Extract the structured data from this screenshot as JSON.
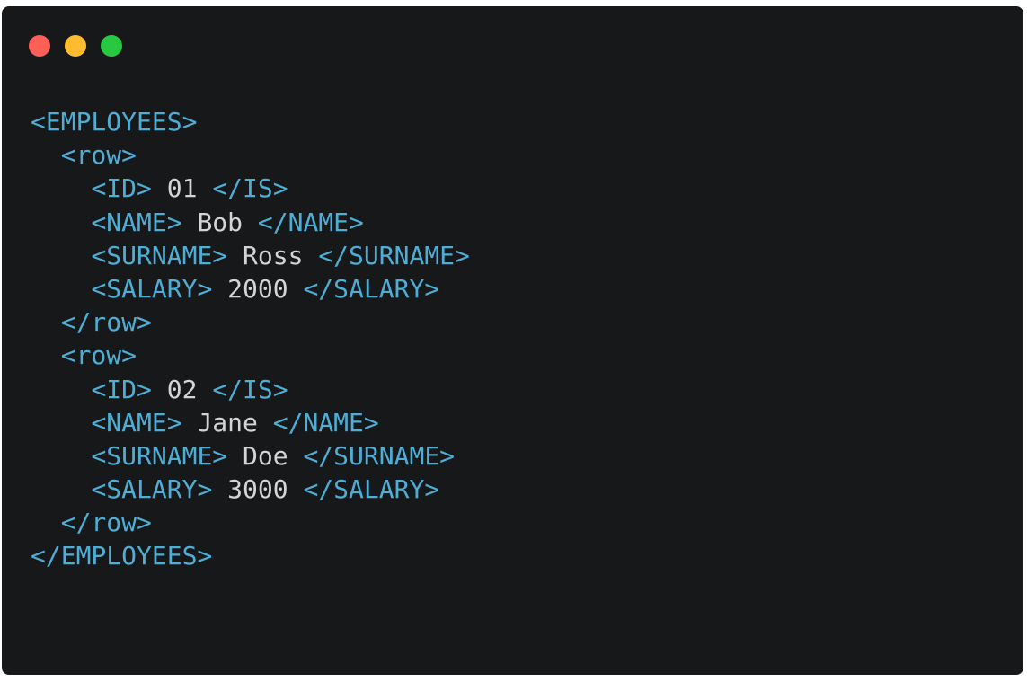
{
  "colors": {
    "background": "#17181a",
    "tag": "#4eaed6",
    "text": "#d4d4d4",
    "close": "#fe5f57",
    "minimize": "#febc2e",
    "zoom": "#28c840"
  },
  "window_controls": [
    {
      "name": "close-button",
      "color": "#fe5f57"
    },
    {
      "name": "minimize-button",
      "color": "#febc2e"
    },
    {
      "name": "zoom-button",
      "color": "#28c840"
    }
  ],
  "code": {
    "employees_open": "<EMPLOYEES>",
    "employees_close": "</EMPLOYEES>",
    "rows": [
      {
        "row_open": "<row>",
        "row_close": "</row>",
        "fields": [
          {
            "open": "<ID>",
            "value": "01",
            "close": "</IS>"
          },
          {
            "open": "<NAME>",
            "value": "Bob",
            "close": "</NAME>"
          },
          {
            "open": "<SURNAME>",
            "value": "Ross",
            "close": "</SURNAME>"
          },
          {
            "open": "<SALARY>",
            "value": "2000",
            "close": "</SALARY>"
          }
        ]
      },
      {
        "row_open": "<row>",
        "row_close": "</row>",
        "fields": [
          {
            "open": "<ID>",
            "value": "02",
            "close": "</IS>"
          },
          {
            "open": "<NAME>",
            "value": "Jane",
            "close": "</NAME>"
          },
          {
            "open": "<SURNAME>",
            "value": "Doe",
            "close": "</SURNAME>"
          },
          {
            "open": "<SALARY>",
            "value": "3000",
            "close": "</SALARY>"
          }
        ]
      }
    ]
  }
}
